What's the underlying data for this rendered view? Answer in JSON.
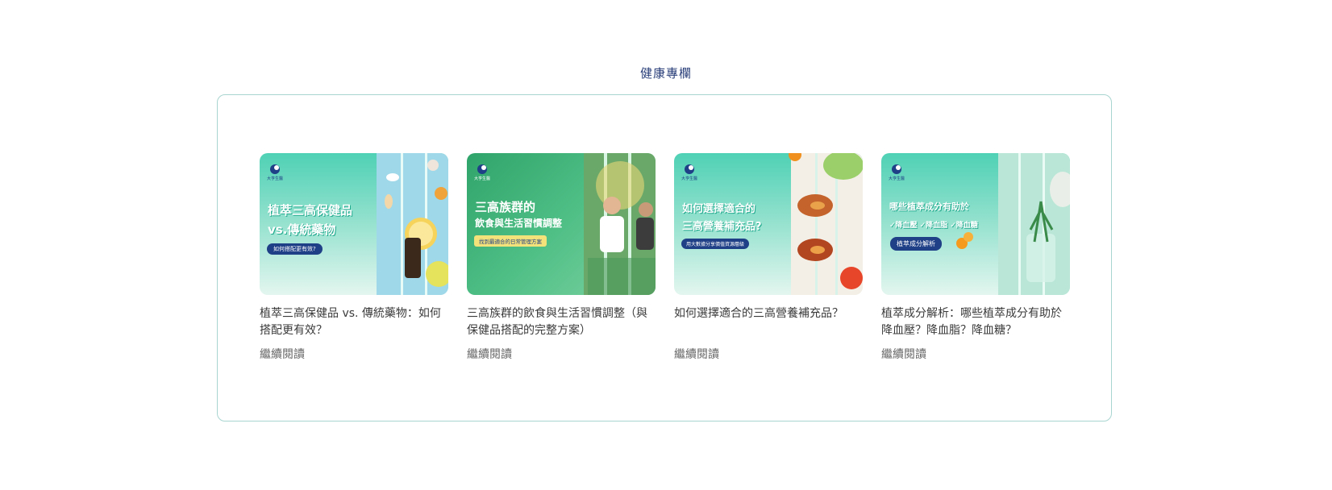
{
  "section": {
    "title": "健康專欄"
  },
  "articles": [
    {
      "title": "植萃三高保健品 vs. 傳統藥物：如何搭配更有效？",
      "read_more": "繼續閱讀",
      "image": {
        "logo": "大亨生醫",
        "headline_1": "植萃三高保健品",
        "headline_2": "vs.傳統藥物",
        "pill": "如何搭配更有效?"
      }
    },
    {
      "title": "三高族群的飲食與生活習慣調整（與保健品搭配的完整方案）",
      "read_more": "繼續閱讀",
      "image": {
        "logo": "大亨生醫",
        "headline_1": "三高族群的",
        "headline_2": "飲食與生活習慣調整",
        "pill": "找到最適合的日常管理方案"
      }
    },
    {
      "title": "如何選擇適合的三高營養補充品？",
      "read_more": "繼續閱讀",
      "image": {
        "logo": "大亨生醫",
        "headline_1": "如何選擇適合的",
        "headline_2": "三高營養補充品?",
        "pill": "用大數據分享價值資源層級"
      }
    },
    {
      "title": "植萃成分解析：哪些植萃成分有助於降血壓？降血脂？降血糖？",
      "read_more": "繼續閱讀",
      "image": {
        "logo": "大亨生醫",
        "headline_1": "哪些植萃成分有助於",
        "headline_2": "✓降血壓 ✓降血脂 ✓降血糖",
        "pill": "植萃成分解析"
      }
    }
  ],
  "colors": {
    "title": "#2a3f7a",
    "border": "#a9d5d0",
    "teal": "#3ec9aa",
    "navy": "#1f3f86"
  }
}
